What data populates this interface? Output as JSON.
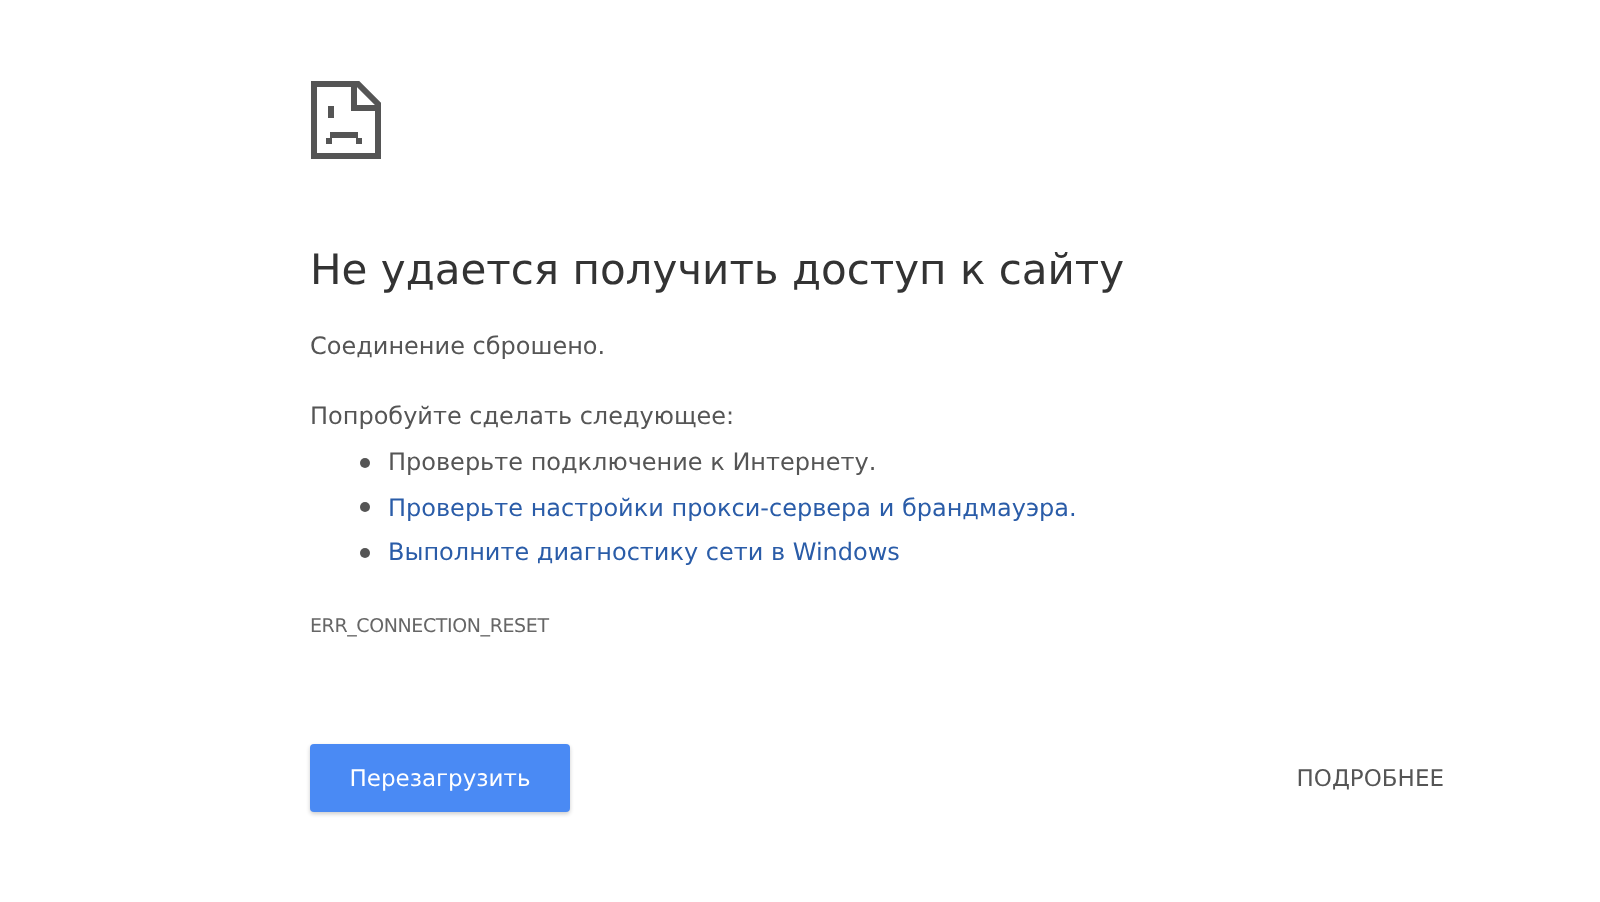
{
  "heading": "Не удается получить доступ к сайту",
  "message": "Соединение сброшено.",
  "suggestions_intro": "Попробуйте сделать следующее:",
  "suggestions": [
    {
      "kind": "text",
      "text": "Проверьте подключение к Интернету."
    },
    {
      "kind": "link",
      "text": "Проверьте настройки прокси-сервера и брандмауэра."
    },
    {
      "kind": "link",
      "text": "Выполните диагностику сети в Windows"
    }
  ],
  "error_code": "ERR_CONNECTION_RESET",
  "buttons": {
    "reload": "Перезагрузить",
    "details": "ПОДРОБНЕЕ"
  }
}
